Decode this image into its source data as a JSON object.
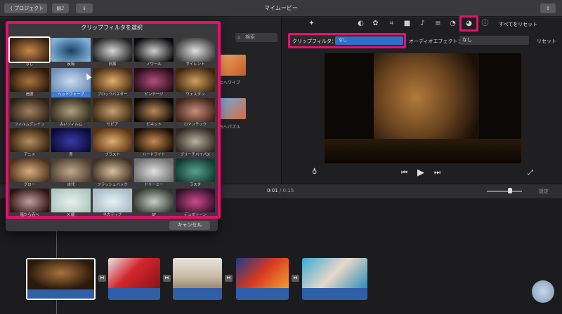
{
  "window": {
    "title": "マイムービー"
  },
  "toolbar": {
    "back_label": "〈 プロジェクト",
    "share_icon": "share-icon",
    "reset_all": "すべてをリセット"
  },
  "browser": {
    "search_placeholder": "検索",
    "media_labels": [
      "上へワイプ",
      "右へパズル"
    ]
  },
  "inspector": {
    "clip_filter_label": "クリップフィルタ：",
    "clip_filter_value": "なし",
    "audio_effect_label": "オーディオエフェクト：",
    "audio_effect_value": "なし",
    "reset_label": "リセット"
  },
  "popup": {
    "title": "クリップフィルタを選択",
    "cancel_label": "キャンセル",
    "filters": [
      [
        "なし",
        "反転",
        "白黒",
        "ノワール",
        "サイレント"
      ],
      [
        "追憶",
        "ヘッドウェーブ",
        "ブロックバスター",
        "ビンテージ",
        "ウェスタン"
      ],
      [
        "フィルムグレイン",
        "古いフィルム",
        "セピア",
        "ビネット",
        "ロマンチック"
      ],
      [
        "アニメ",
        "青",
        "ブラスト",
        "ハードライト",
        "ブリーチバイパス"
      ],
      [
        "グロー",
        "古代",
        "フラッシュバック",
        "ドリーミー",
        "ラスタ"
      ],
      [
        "暗から赤へ",
        "X 線",
        "ネガティブ",
        "SF",
        "デュオトーン"
      ]
    ],
    "selected_filter": "なし",
    "hovered_filter": "ヘッドウェーブ"
  },
  "timeline": {
    "current_time": "0:01",
    "separator": " / ",
    "total_time": "0:15",
    "settings_label": "設定"
  },
  "colors": {
    "accent": "#e5106e",
    "selection": "#2f6fc6"
  }
}
